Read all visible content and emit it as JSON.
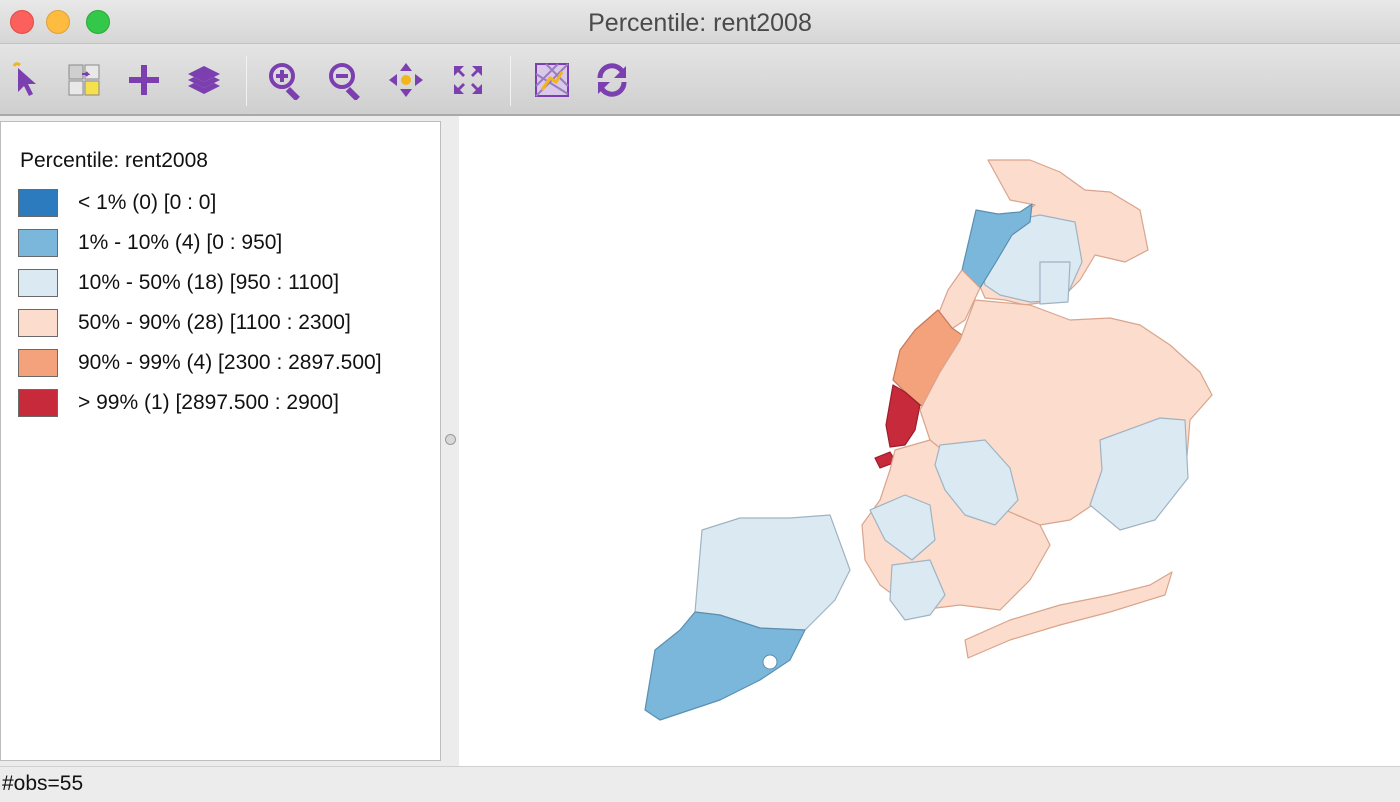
{
  "window": {
    "title": "Percentile: rent2008"
  },
  "toolbar": {
    "tools": [
      {
        "name": "select-tool",
        "icon": "arrow-cursor-icon"
      },
      {
        "name": "selection-toggle",
        "icon": "selection-shapes-icon"
      },
      {
        "name": "add-layer",
        "icon": "plus-icon"
      },
      {
        "name": "layers",
        "icon": "layers-icon"
      },
      {
        "name": "zoom-in",
        "icon": "zoom-in-icon"
      },
      {
        "name": "zoom-out",
        "icon": "zoom-out-icon"
      },
      {
        "name": "pan",
        "icon": "pan-arrows-icon"
      },
      {
        "name": "full-extent",
        "icon": "fit-extent-icon"
      },
      {
        "name": "basemap",
        "icon": "basemap-icon"
      },
      {
        "name": "refresh",
        "icon": "refresh-icon"
      }
    ],
    "accent_color": "#7b3fb0"
  },
  "legend": {
    "title": "Percentile: rent2008",
    "items": [
      {
        "label": "< 1% (0)  [0 : 0]",
        "color": "#2c7bbf"
      },
      {
        "label": "1% - 10% (4)  [0 : 950]",
        "color": "#7bb7da"
      },
      {
        "label": "10% - 50% (18)  [950 : 1100]",
        "color": "#dbe9f3"
      },
      {
        "label": "50% - 90% (28)  [1100 : 2300]",
        "color": "#fbdccd"
      },
      {
        "label": "90% - 99% (4)  [2300 : 2897.500]",
        "color": "#f3a27c"
      },
      {
        "label": "> 99% (1)  [2897.500 : 2900]",
        "color": "#c62a3b"
      }
    ]
  },
  "status": {
    "text": "#obs=55"
  }
}
